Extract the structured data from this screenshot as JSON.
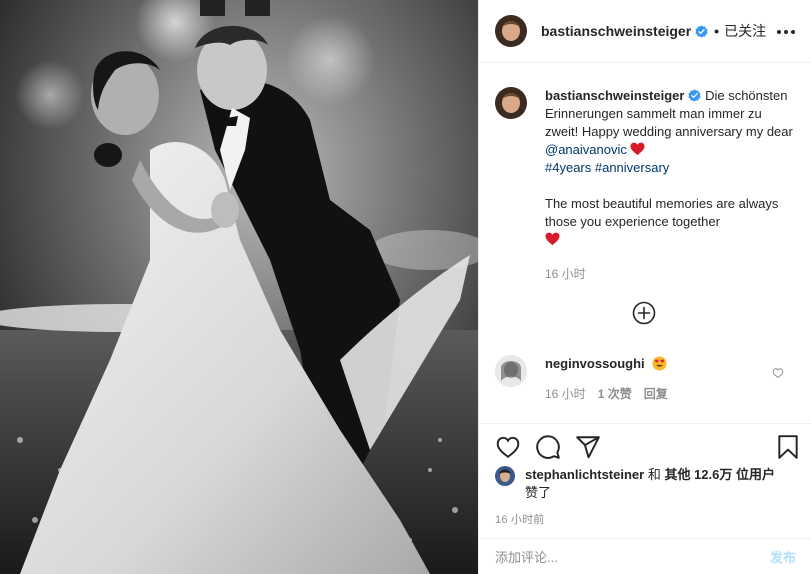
{
  "post": {
    "author": "bastianschweinsteiger",
    "follow_label": "已关注",
    "caption": {
      "line1": "Die schönsten Erinnerungen sammelt man immer zu zweit! Happy wedding anniversary my dear ",
      "mention": "@anaivanovic",
      "hashtags": "#4years #anniversary",
      "line2": "The most beautiful memories are always those you experience together"
    },
    "caption_time": "16 小时",
    "comment": {
      "author": "neginvossoughi",
      "emoji": "heart-eyes",
      "time": "16 小时",
      "likes": "1 次赞",
      "reply": "回复"
    },
    "likes": {
      "user": "stephanlichtsteiner",
      "text_mid": " 和 ",
      "count": "其他 12.6万 位用户",
      "text_end": "赞了"
    },
    "post_time": "16 小时前",
    "add_comment_placeholder": "添加评论...",
    "post_button": "发布"
  },
  "icons": {
    "header_more": "more-horizontal-icon",
    "verified": "verified-badge-icon",
    "load_more": "plus-circle-icon",
    "like": "heart-icon",
    "comment": "comment-icon",
    "share": "share-icon",
    "save": "bookmark-icon"
  },
  "colors": {
    "link": "#00376b",
    "muted": "#8e8e8e",
    "verified": "#3897f0",
    "heart": "#ed4956",
    "post_disabled": "#b2dffc"
  }
}
